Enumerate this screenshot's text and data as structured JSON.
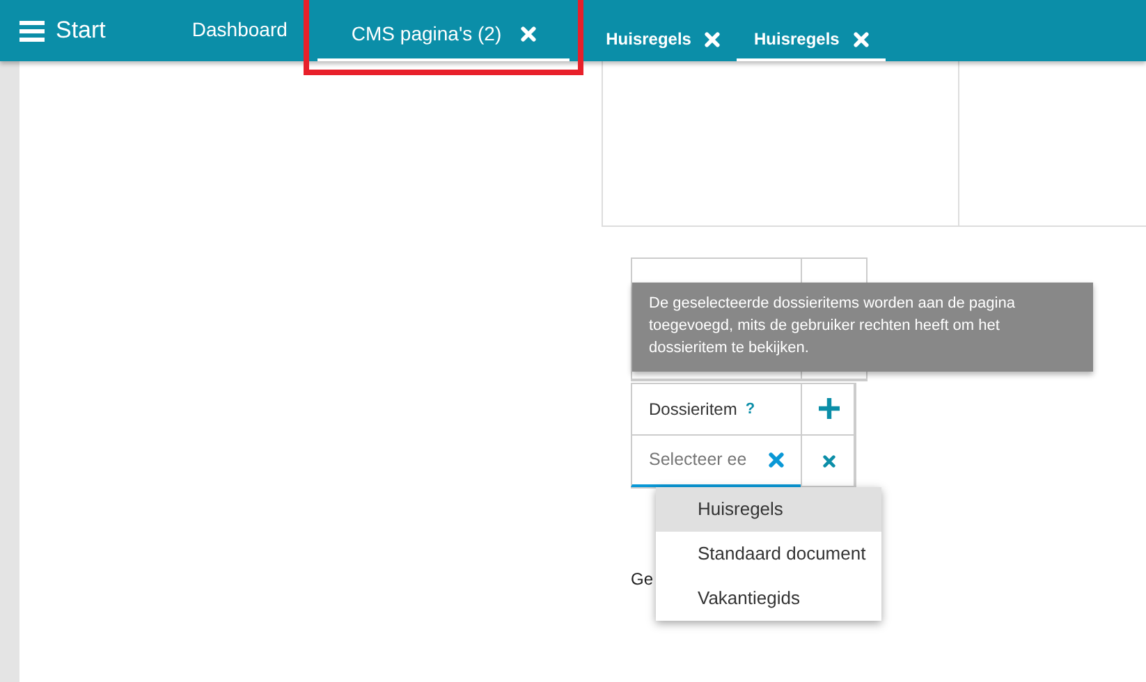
{
  "app": {
    "title": "Start"
  },
  "tabs": [
    {
      "label": "Dashboard",
      "selected": false,
      "closable": false,
      "highlighted": false
    },
    {
      "label": "CMS pagina's (2)",
      "selected": true,
      "closable": true,
      "highlighted": true
    }
  ],
  "subtabs": [
    {
      "label": "Huisregels",
      "selected": false
    },
    {
      "label": "Huisregels",
      "selected": true
    }
  ],
  "field_groups": [
    {
      "kind": "covered"
    },
    {
      "kind": "select",
      "label": "Dossieritem",
      "help": "?",
      "placeholder": "Selecteer ee"
    }
  ],
  "tooltip": {
    "text": "De geselecteerde dossieritems worden aan de pagina toegevoegd, mits de gebruiker rechten heeft om het dossieritem te bekijken."
  },
  "dropdown": {
    "items": [
      {
        "label": "Huisregels",
        "selected": true
      },
      {
        "label": "Standaard document",
        "selected": false
      },
      {
        "label": "Vakantiegids",
        "selected": false
      }
    ]
  },
  "partial_text": "Ge"
}
